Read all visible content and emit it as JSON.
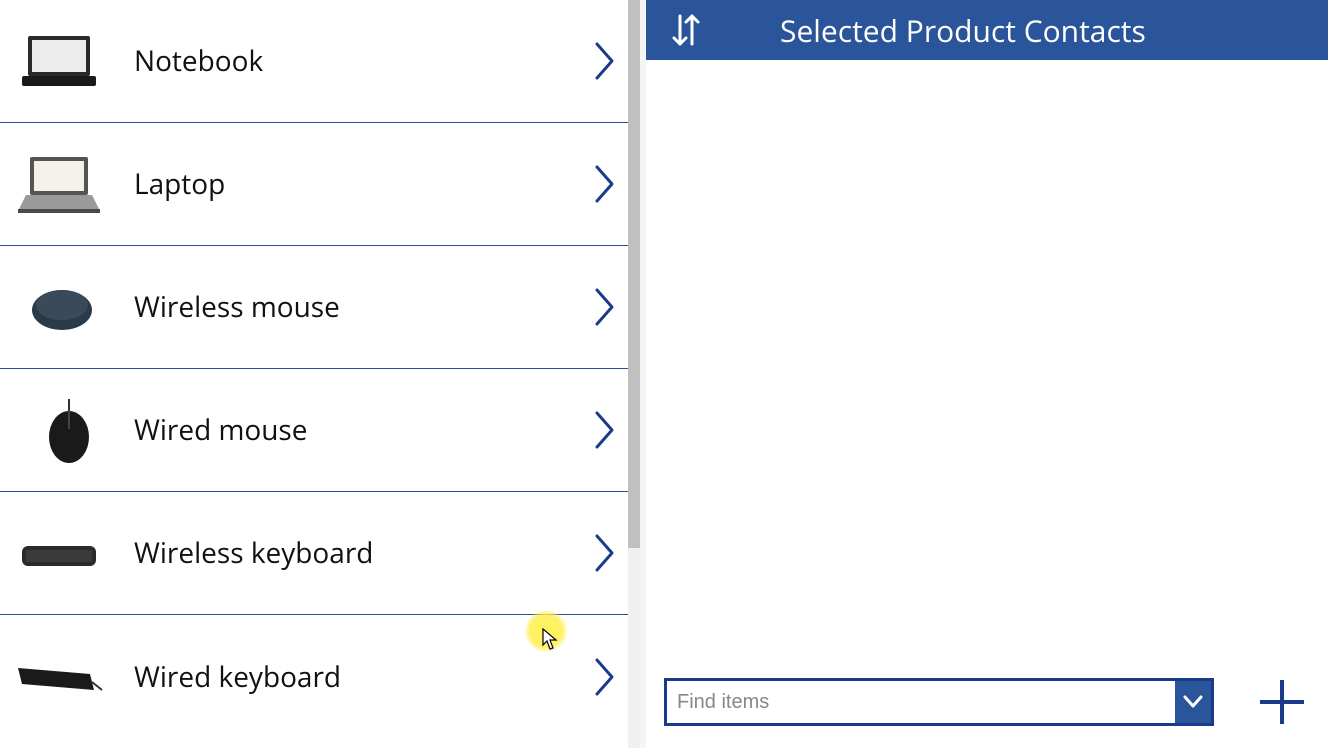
{
  "left": {
    "products": [
      {
        "label": "Notebook",
        "icon": "notebook"
      },
      {
        "label": "Laptop",
        "icon": "laptop"
      },
      {
        "label": "Wireless mouse",
        "icon": "wireless-mouse"
      },
      {
        "label": "Wired mouse",
        "icon": "wired-mouse"
      },
      {
        "label": "Wireless keyboard",
        "icon": "wireless-keyboard"
      },
      {
        "label": "Wired keyboard",
        "icon": "wired-keyboard"
      }
    ]
  },
  "right": {
    "title": "Selected Product Contacts",
    "find_placeholder": "Find items"
  },
  "colors": {
    "accent": "#2b559b",
    "divider": "#2b4b9b"
  }
}
